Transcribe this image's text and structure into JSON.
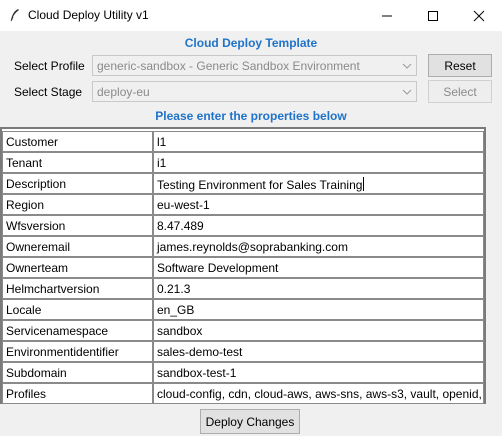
{
  "window": {
    "title": "Cloud Deploy Utility v1"
  },
  "header": {
    "template_title": "Cloud Deploy Template",
    "properties_prompt": "Please enter the properties below"
  },
  "profile": {
    "label": "Select Profile",
    "value": "generic-sandbox - Generic Sandbox Environment",
    "button": "Reset"
  },
  "stage": {
    "label": "Select Stage",
    "value": "deploy-eu",
    "button": "Select"
  },
  "properties": [
    {
      "key": "Customer",
      "value": "l1"
    },
    {
      "key": "Tenant",
      "value": "i1"
    },
    {
      "key": "Description",
      "value": "Testing Environment for Sales Training"
    },
    {
      "key": "Region",
      "value": "eu-west-1"
    },
    {
      "key": "Wfsversion",
      "value": "8.47.489"
    },
    {
      "key": "Owneremail",
      "value": "james.reynolds@soprabanking.com"
    },
    {
      "key": "Ownerteam",
      "value": "Software Development"
    },
    {
      "key": "Helmchartversion",
      "value": "0.21.3"
    },
    {
      "key": "Locale",
      "value": "en_GB"
    },
    {
      "key": "Servicenamespace",
      "value": "sandbox"
    },
    {
      "key": "Environmentidentifier",
      "value": "sales-demo-test"
    },
    {
      "key": "Subdomain",
      "value": "sandbox-test-1"
    },
    {
      "key": "Profiles",
      "value": "cloud-config, cdn, cloud-aws, aws-sns, aws-s3, vault, openid,"
    }
  ],
  "footer": {
    "deploy_button": "Deploy Changes"
  },
  "colors": {
    "heading": "#1f73c9",
    "window_bg": "#f0f0f0"
  },
  "icons": {
    "app": "feather-icon",
    "minimize": "minimize-icon",
    "maximize": "maximize-icon",
    "close": "close-icon",
    "dropdown": "chevron-down-icon"
  }
}
